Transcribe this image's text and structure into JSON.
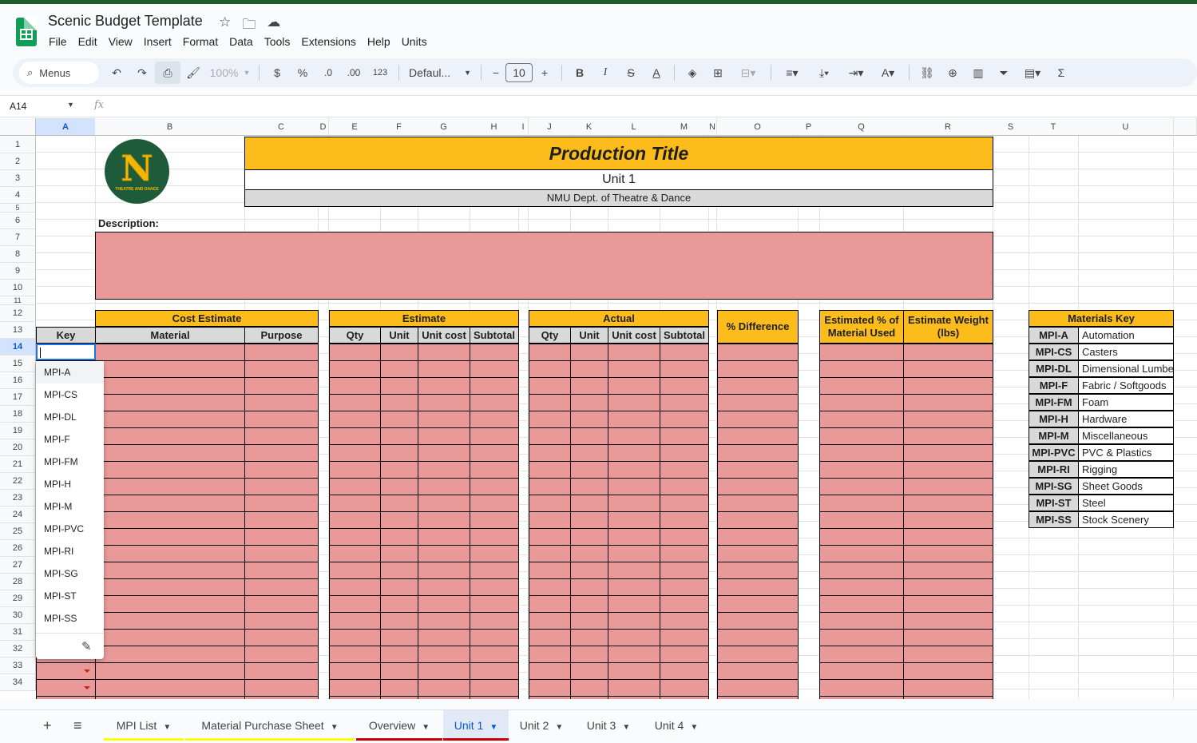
{
  "app": {
    "title": "Scenic Budget Template"
  },
  "menu": [
    "File",
    "Edit",
    "View",
    "Insert",
    "Format",
    "Data",
    "Tools",
    "Extensions",
    "Help",
    "Units"
  ],
  "toolbar": {
    "search_label": "Menus",
    "zoom": "100%",
    "currency": "$",
    "percent": "%",
    "dec_decrease": ".0",
    "dec_increase": ".00",
    "number_format": "123",
    "font": "Defaul...",
    "font_size": "10"
  },
  "formula": {
    "namebox": "A14",
    "fx": "fx"
  },
  "columns": [
    "A",
    "B",
    "C",
    "D",
    "E",
    "F",
    "G",
    "H",
    "I",
    "J",
    "K",
    "L",
    "M",
    "N",
    "O",
    "P",
    "Q",
    "R",
    "S",
    "T",
    "U"
  ],
  "rows": [
    "1",
    "2",
    "3",
    "4",
    "5",
    "6",
    "7",
    "8",
    "9",
    "10",
    "11",
    "12",
    "13",
    "14",
    "15",
    "16",
    "17",
    "18",
    "19",
    "20",
    "21",
    "22",
    "23",
    "24",
    "25",
    "26",
    "27",
    "28",
    "29",
    "30",
    "31",
    "32",
    "33",
    "34"
  ],
  "header_block": {
    "production_title": "Production Title",
    "unit": "Unit 1",
    "dept": "NMU Dept. of Theatre & Dance",
    "logo_letter": "N",
    "logo_text": "THEATRE AND DANCE"
  },
  "description_label": "Description:",
  "table": {
    "cost_estimate": "Cost Estimate",
    "estimate": "Estimate",
    "actual": "Actual",
    "pct_difference": "% Difference",
    "est_pct_used": "Estimated % of Material Used",
    "est_weight": "Estimate Weight (lbs)",
    "key": "Key",
    "material": "Material",
    "purpose": "Purpose",
    "qty": "Qty",
    "unit": "Unit",
    "unit_cost": "Unit cost",
    "subtotal": "Subtotal"
  },
  "materials_key": {
    "title": "Materials Key",
    "items": [
      {
        "code": "MPI-A",
        "name": "Automation"
      },
      {
        "code": "MPI-CS",
        "name": "Casters"
      },
      {
        "code": "MPI-DL",
        "name": "Dimensional Lumber"
      },
      {
        "code": "MPI-F",
        "name": "Fabric / Softgoods"
      },
      {
        "code": "MPI-FM",
        "name": "Foam"
      },
      {
        "code": "MPI-H",
        "name": "Hardware"
      },
      {
        "code": "MPI-M",
        "name": "Miscellaneous"
      },
      {
        "code": "MPI-PVC",
        "name": "PVC & Plastics"
      },
      {
        "code": "MPI-RI",
        "name": "Rigging"
      },
      {
        "code": "MPI-SG",
        "name": "Sheet Goods"
      },
      {
        "code": "MPI-ST",
        "name": "Steel"
      },
      {
        "code": "MPI-SS",
        "name": "Stock Scenery"
      }
    ]
  },
  "dropdown_options": [
    "MPI-A",
    "MPI-CS",
    "MPI-DL",
    "MPI-F",
    "MPI-FM",
    "MPI-H",
    "MPI-M",
    "MPI-PVC",
    "MPI-RI",
    "MPI-SG",
    "MPI-ST",
    "MPI-SS"
  ],
  "sheet_tabs": [
    {
      "label": "MPI List",
      "color": "#ffff00",
      "active": false
    },
    {
      "label": "Material Purchase Sheet",
      "color": "#ffff00",
      "active": false
    },
    {
      "label": "Overview",
      "color": "#cc0000",
      "active": false
    },
    {
      "label": "Unit 1",
      "color": "#cc0000",
      "active": true
    },
    {
      "label": "Unit 2",
      "color": "",
      "active": false
    },
    {
      "label": "Unit 3",
      "color": "",
      "active": false
    },
    {
      "label": "Unit 4",
      "color": "",
      "active": false
    }
  ],
  "colors": {
    "gold": "#fbbc1c",
    "pink": "#ea9999",
    "grey": "#d9d9d9",
    "brand_green": "#0f9d58",
    "logo_green": "#1e5b3a"
  }
}
